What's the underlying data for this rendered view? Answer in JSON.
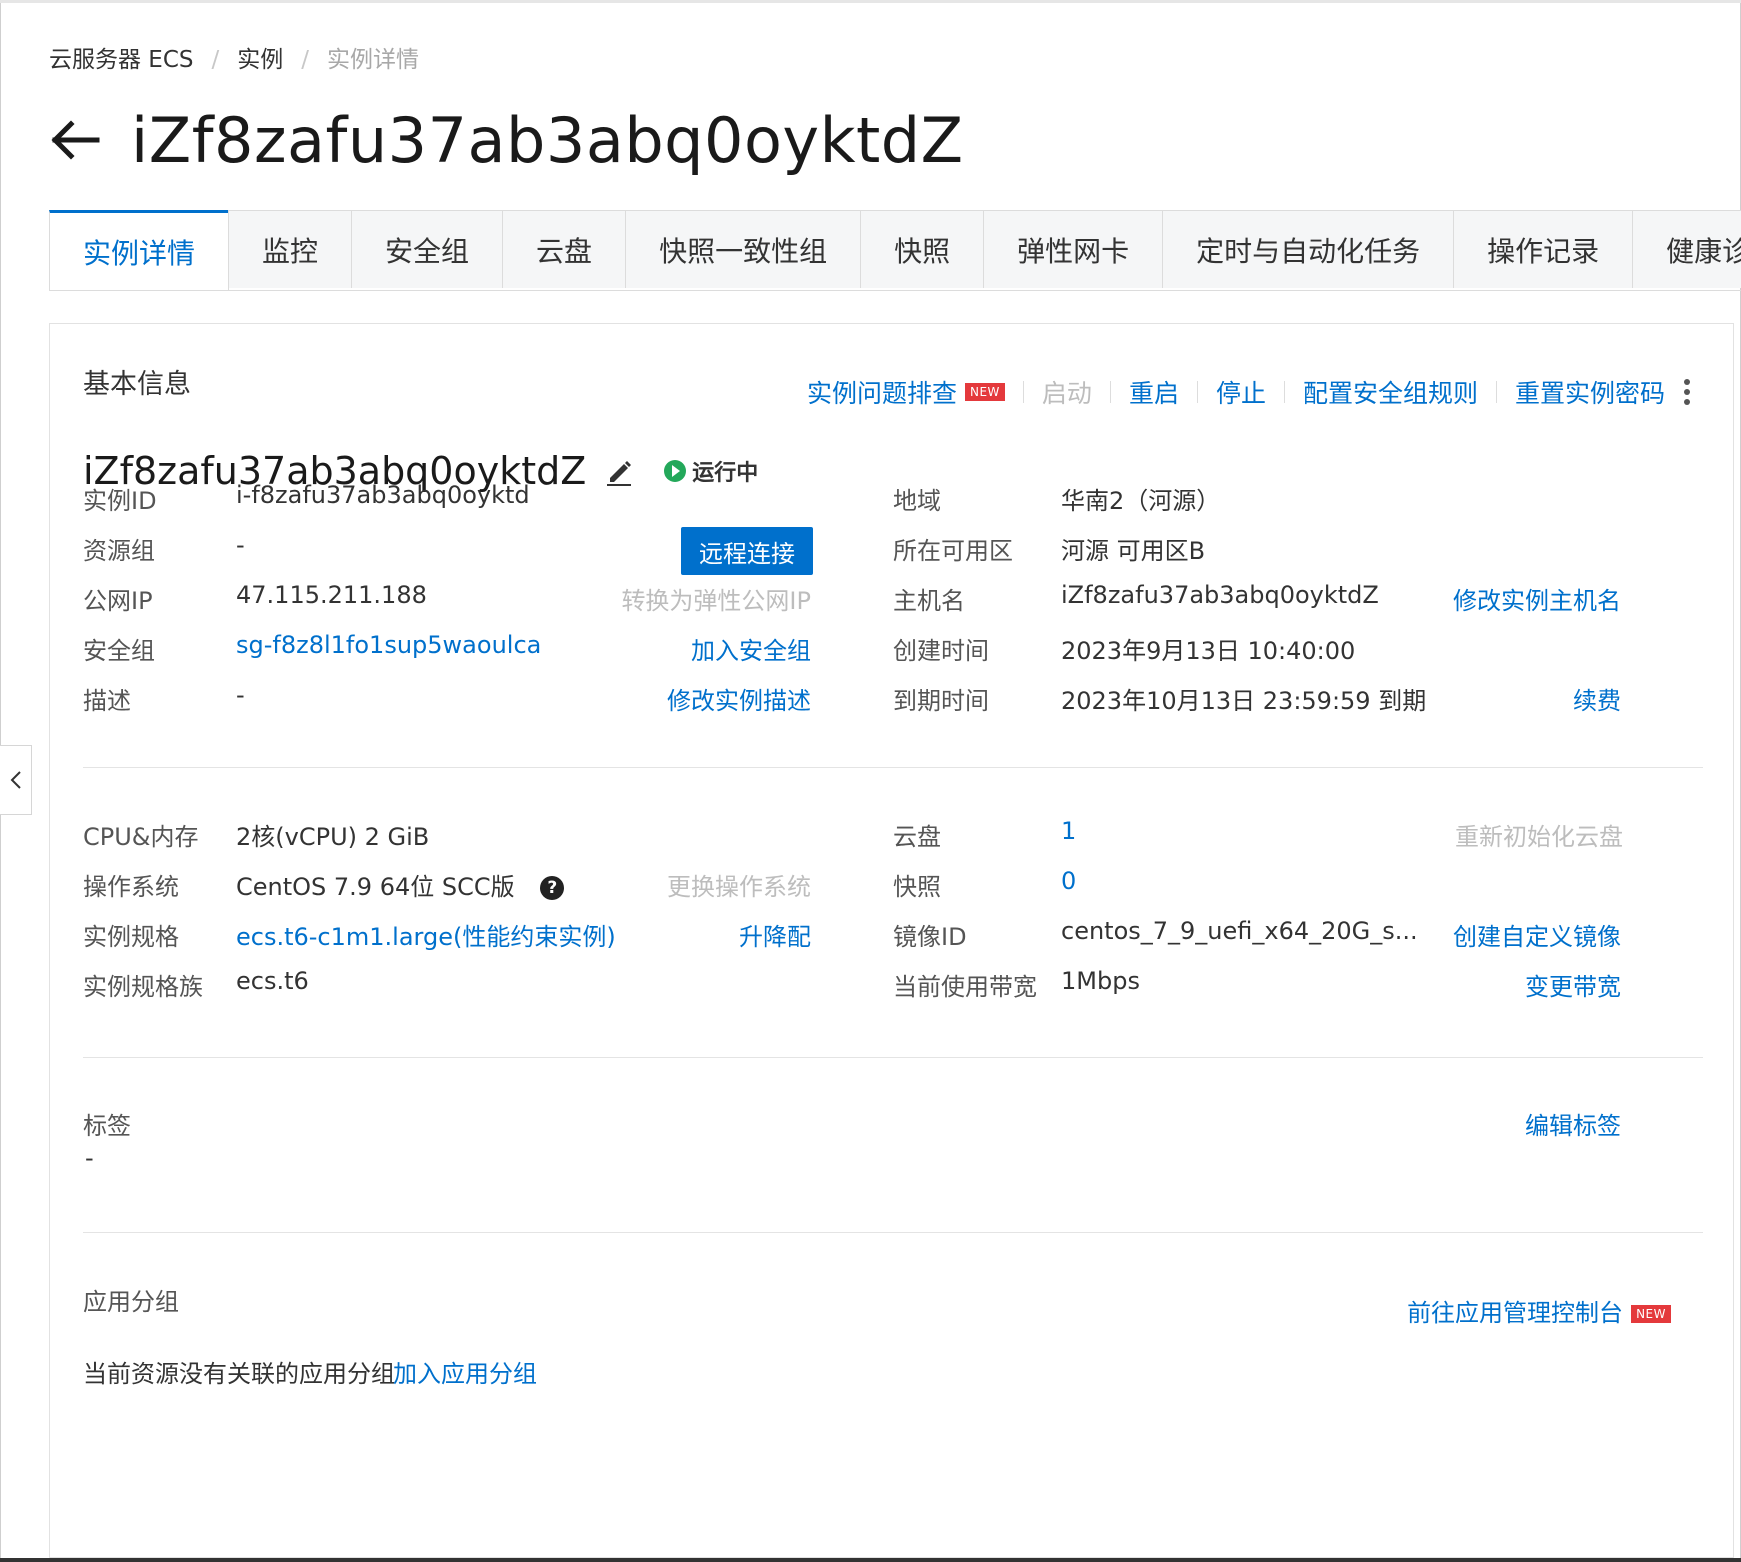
{
  "breadcrumb": [
    "云服务器 ECS",
    "实例",
    "实例详情"
  ],
  "page_title": "iZf8zafu37ab3abq0oyktdZ",
  "tabs": [
    "实例详情",
    "监控",
    "安全组",
    "云盘",
    "快照一致性组",
    "快照",
    "弹性网卡",
    "定时与自动化任务",
    "操作记录",
    "健康诊"
  ],
  "basic_info": {
    "title": "基本信息",
    "actions": {
      "troubleshoot": "实例问题排查",
      "new_badge": "NEW",
      "start": "启动",
      "restart": "重启",
      "stop": "停止",
      "config_sg_rules": "配置安全组规则",
      "reset_password": "重置实例密码"
    },
    "instance_name": "iZf8zafu37ab3abq0oyktdZ",
    "status": "运行中",
    "remote_connect": "远程连接",
    "fields": {
      "instance_id": {
        "label": "实例ID",
        "value": "i-f8zafu37ab3abq0oyktd"
      },
      "resource_group": {
        "label": "资源组",
        "value": "-"
      },
      "public_ip": {
        "label": "公网IP",
        "value": "47.115.211.188",
        "action": "转换为弹性公网IP"
      },
      "security_group": {
        "label": "安全组",
        "value": "sg-f8z8l1fo1sup5waoulca",
        "action": "加入安全组"
      },
      "description": {
        "label": "描述",
        "value": "-",
        "action": "修改实例描述"
      },
      "region": {
        "label": "地域",
        "value": "华南2（河源）"
      },
      "zone": {
        "label": "所在可用区",
        "value": "河源 可用区B"
      },
      "hostname": {
        "label": "主机名",
        "value": "iZf8zafu37ab3abq0oyktdZ",
        "action": "修改实例主机名"
      },
      "created": {
        "label": "创建时间",
        "value": "2023年9月13日 10:40:00"
      },
      "expires": {
        "label": "到期时间",
        "value": "2023年10月13日 23:59:59 到期",
        "action": "续费"
      }
    },
    "config": {
      "cpu_mem": {
        "label": "CPU&内存",
        "value": "2核(vCPU) 2 GiB"
      },
      "os": {
        "label": "操作系统",
        "value": "CentOS 7.9 64位 SCC版",
        "action": "更换操作系统"
      },
      "spec": {
        "label": "实例规格",
        "value": "ecs.t6-c1m1.large(性能约束实例)",
        "action": "升降配"
      },
      "spec_family": {
        "label": "实例规格族",
        "value": "ecs.t6"
      },
      "disk": {
        "label": "云盘",
        "value": "1",
        "action": "重新初始化云盘"
      },
      "snapshot": {
        "label": "快照",
        "value": "0"
      },
      "image_id": {
        "label": "镜像ID",
        "value": "centos_7_9_uefi_x64_20G_s...",
        "action": "创建自定义镜像"
      },
      "bandwidth": {
        "label": "当前使用带宽",
        "value": "1Mbps",
        "action": "变更带宽"
      }
    },
    "tags": {
      "label": "标签",
      "value": "-",
      "action": "编辑标签"
    },
    "app_group": {
      "label": "应用分组",
      "goto": "前往应用管理控制台",
      "new_badge": "NEW",
      "empty_text": "当前资源没有关联的应用分组",
      "join": "加入应用分组"
    }
  },
  "colors": {
    "link": "#0070cc",
    "status_green": "#23a85a",
    "badge_red": "#e4393c"
  }
}
